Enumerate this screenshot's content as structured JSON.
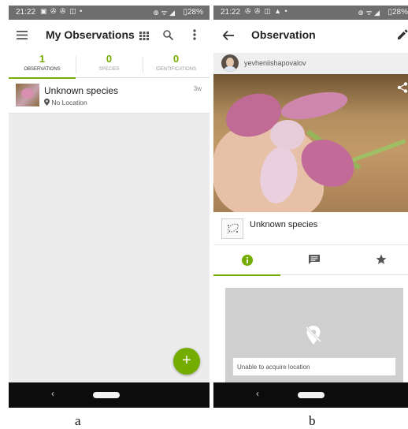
{
  "panel_a": {
    "status_bar": {
      "time": "21:22",
      "battery": "28%"
    },
    "app_bar": {
      "title": "My Observations"
    },
    "tabs": [
      {
        "count": "1",
        "label": "OBSERVATIONS"
      },
      {
        "count": "0",
        "label": "SPECIES"
      },
      {
        "count": "0",
        "label": "IDENTIFICATIONS"
      }
    ],
    "observation": {
      "name": "Unknown species",
      "location": "No Location",
      "age": "3w"
    },
    "fab_label": "+",
    "caption": "a"
  },
  "panel_b": {
    "status_bar": {
      "time": "21:22",
      "battery": "28%"
    },
    "app_bar": {
      "title": "Observation"
    },
    "user": {
      "username": "yevheniishapovalov"
    },
    "species": {
      "name": "Unknown species"
    },
    "location_field": "Unable to acquire location",
    "caption": "b"
  },
  "icons": {
    "menu": "hamburger-icon",
    "grid": "grid-icon",
    "search": "search-icon",
    "more": "more-vert-icon",
    "back": "arrow-back-icon",
    "edit": "pencil-icon",
    "share": "share-icon",
    "info": "info-icon",
    "comments": "comment-icon",
    "favorite": "star-icon",
    "location_off": "location-off-icon"
  },
  "colors": {
    "accent": "#74ac00",
    "status_bar": "#6e6e6e",
    "nav_bar": "#0c0c0c",
    "empty_background": "#ececec"
  }
}
